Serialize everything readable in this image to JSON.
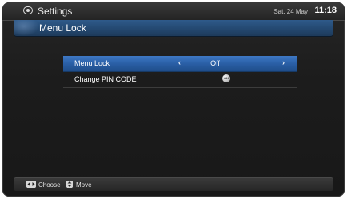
{
  "header": {
    "title": "Settings",
    "date": "Sat, 24 May",
    "time": "11:18",
    "icon": "settings-icon"
  },
  "page": {
    "title": "Menu Lock"
  },
  "menu": {
    "items": [
      {
        "label": "Menu Lock",
        "value": "Off",
        "left_arrow": "‹",
        "right_arrow": "›"
      },
      {
        "label": "Change PIN CODE",
        "ok_icon_text": "OK"
      }
    ]
  },
  "footer": {
    "hints": [
      {
        "icon": "left-right-arrows-icon",
        "label": "Choose"
      },
      {
        "icon": "up-down-arrows-icon",
        "label": "Move"
      }
    ]
  },
  "colors": {
    "selected_row": "#2a5fa6",
    "title_bar": "#254a73",
    "background": "#1c1c1c"
  }
}
